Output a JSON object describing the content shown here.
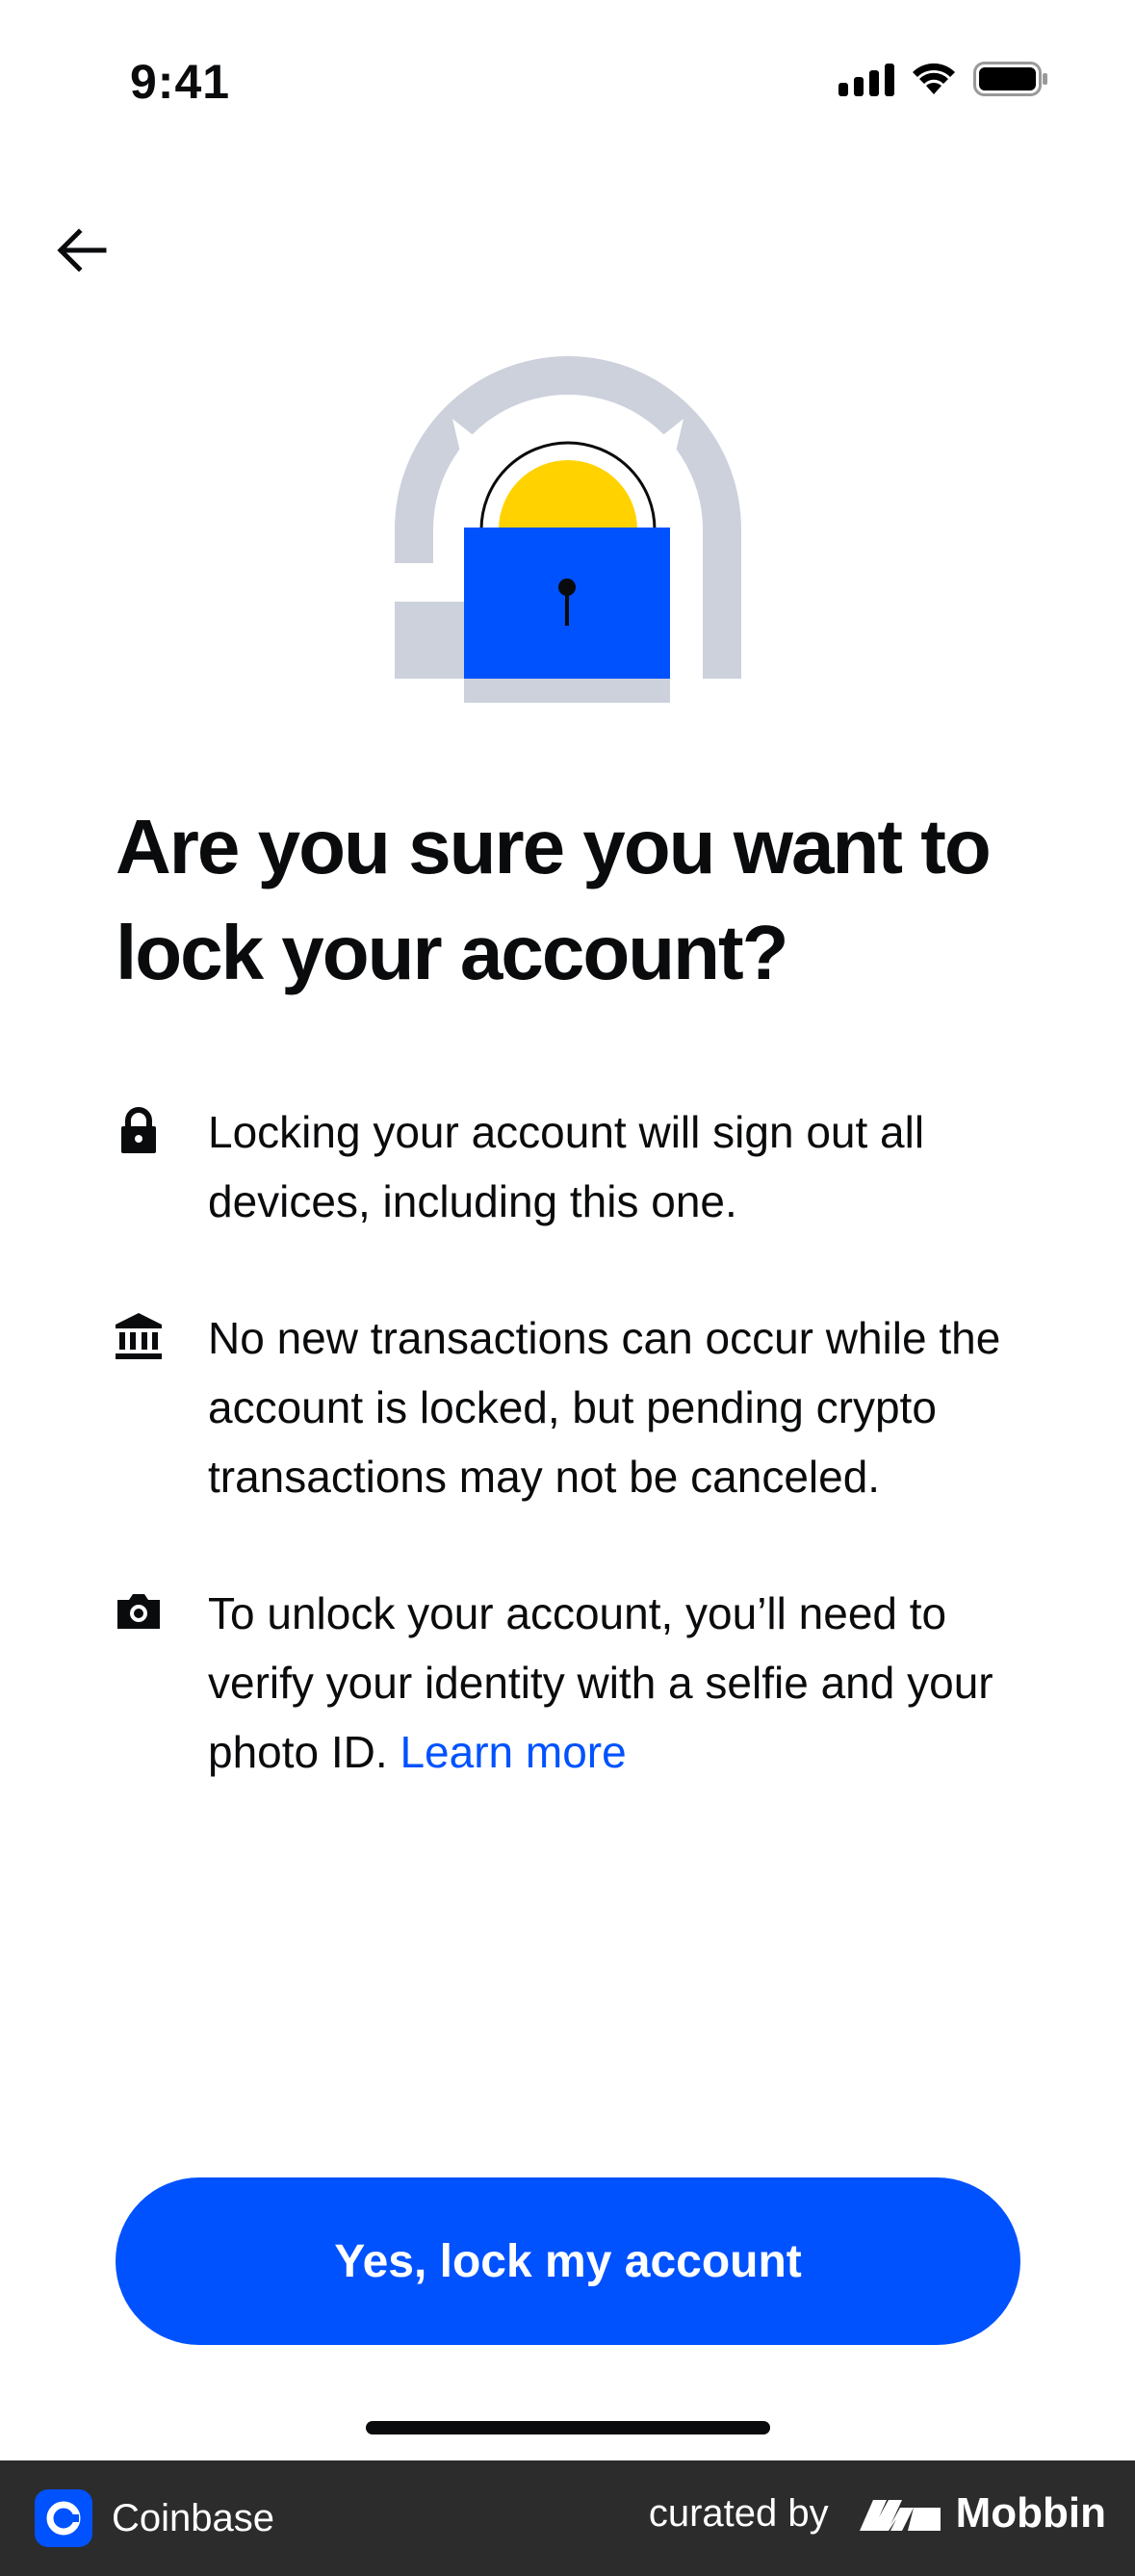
{
  "status_bar": {
    "time": "9:41"
  },
  "header": {
    "back_icon": "arrow-left-icon"
  },
  "illustration": {
    "icon": "padlock-illustration",
    "colors": {
      "arch": "#ccd1dc",
      "sun": "#ffd200",
      "lock": "#0052ff"
    }
  },
  "headline": "Are you sure you want to lock your account?",
  "info_items": [
    {
      "icon": "lock-icon",
      "text": "Locking your account will sign out all devices, including this one."
    },
    {
      "icon": "bank-icon",
      "text": "No new transactions can occur while the account is locked, but pending crypto transactions may not be canceled."
    },
    {
      "icon": "camera-icon",
      "text": "To unlock your account, you’ll need to verify your identity with a selfie and your photo ID.",
      "link": "Learn more"
    }
  ],
  "primary_button": {
    "label": "Yes, lock my account"
  },
  "footer": {
    "app_name": "Coinbase",
    "curated_by": "curated by",
    "brand": "Mobbin"
  },
  "colors": {
    "accent": "#0052ff",
    "text": "#0a0b0d",
    "footer_bg": "#2c2c2c"
  }
}
